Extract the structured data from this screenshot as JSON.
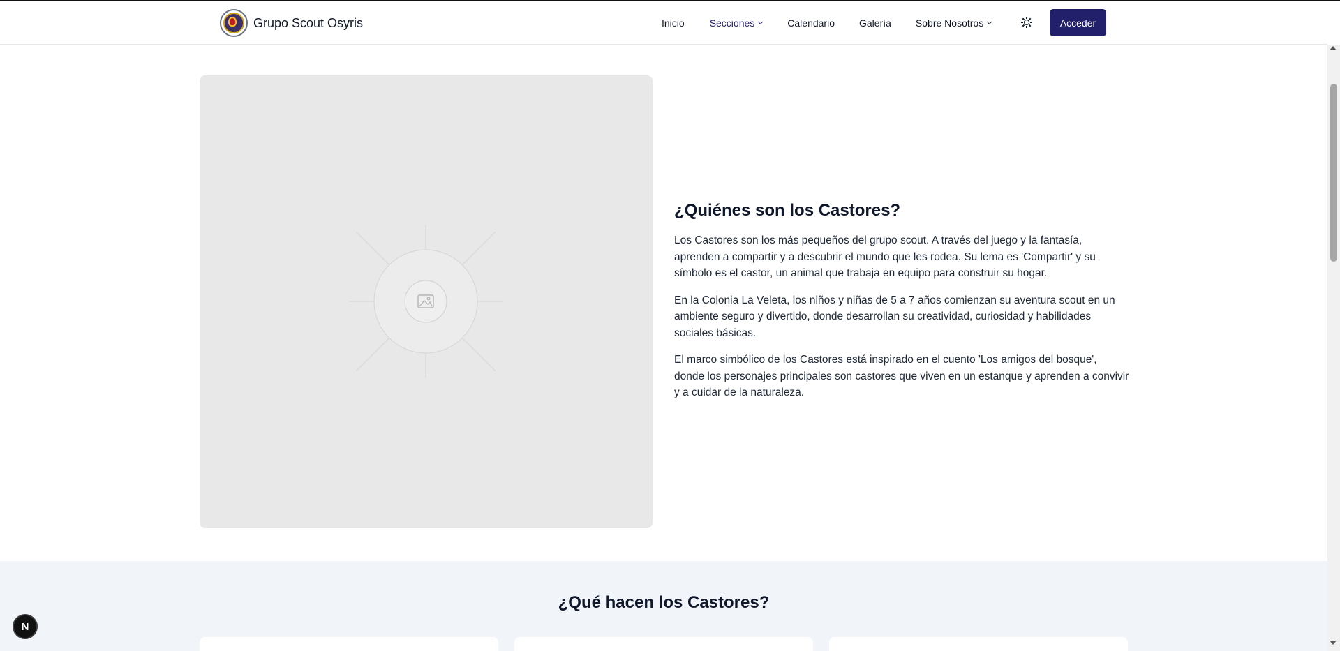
{
  "header": {
    "brand_name": "Grupo Scout Osyris",
    "nav": [
      {
        "label": "Inicio",
        "has_dropdown": false,
        "active": false
      },
      {
        "label": "Secciones",
        "has_dropdown": true,
        "active": true
      },
      {
        "label": "Calendario",
        "has_dropdown": false,
        "active": false
      },
      {
        "label": "Galería",
        "has_dropdown": false,
        "active": false
      },
      {
        "label": "Sobre Nosotros",
        "has_dropdown": true,
        "active": false
      }
    ],
    "theme_icon": "sun-icon",
    "login_label": "Acceder"
  },
  "intro": {
    "title": "¿Quiénes son los Castores?",
    "paragraphs": [
      "Los Castores son los más pequeños del grupo scout. A través del juego y la fantasía, aprenden a compartir y a descubrir el mundo que les rodea. Su lema es 'Compartir' y su símbolo es el castor, un animal que trabaja en equipo para construir su hogar.",
      "En la Colonia La Veleta, los niños y niñas de 5 a 7 años comienzan su aventura scout en un ambiente seguro y divertido, donde desarrollan su creatividad, curiosidad y habilidades sociales básicas.",
      "El marco simbólico de los Castores está inspirado en el cuento 'Los amigos del bosque', donde los personajes principales son castores que viven en un estanque y aprenden a convivir y a cuidar de la naturaleza."
    ]
  },
  "activities": {
    "title": "¿Qué hacen los Castores?"
  },
  "dev_badge": {
    "label": "N"
  },
  "colors": {
    "primary": "#23206b",
    "section_bg": "#f1f5f9",
    "placeholder_bg": "#e8e8e8"
  }
}
